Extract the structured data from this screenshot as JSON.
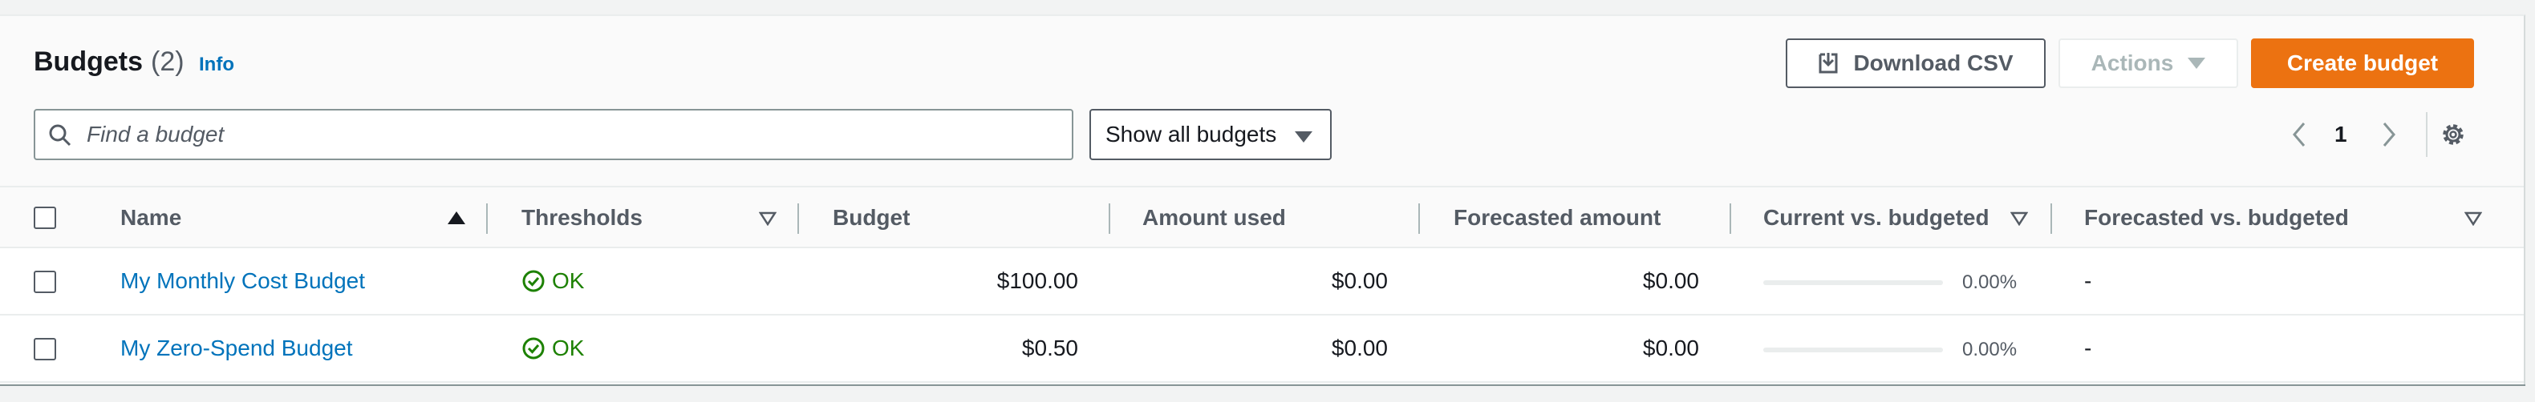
{
  "header": {
    "title": "Budgets",
    "count": "(2)",
    "info_label": "Info"
  },
  "toolbar": {
    "download_label": "Download CSV",
    "actions_label": "Actions",
    "create_label": "Create budget"
  },
  "search": {
    "placeholder": "Find a budget",
    "value": ""
  },
  "filter": {
    "selected": "Show all budgets"
  },
  "pagination": {
    "current_page": "1"
  },
  "table": {
    "columns": [
      {
        "label": "Name",
        "sort": "ascending"
      },
      {
        "label": "Thresholds",
        "sort": "sortable"
      },
      {
        "label": "Budget",
        "sort": "none"
      },
      {
        "label": "Amount used",
        "sort": "none"
      },
      {
        "label": "Forecasted amount",
        "sort": "none"
      },
      {
        "label": "Current vs. budgeted",
        "sort": "sortable"
      },
      {
        "label": "Forecasted vs. budgeted",
        "sort": "sortable"
      }
    ],
    "rows": [
      {
        "name": "My Monthly Cost Budget",
        "threshold": "OK",
        "budget": "$100.00",
        "amount_used": "$0.00",
        "forecasted": "$0.00",
        "current_vs_budgeted_pct": "0.00%",
        "current_vs_budgeted_fraction": 0,
        "forecasted_vs_budgeted": "-"
      },
      {
        "name": "My Zero-Spend Budget",
        "threshold": "OK",
        "budget": "$0.50",
        "amount_used": "$0.00",
        "forecasted": "$0.00",
        "current_vs_budgeted_pct": "0.00%",
        "current_vs_budgeted_fraction": 0,
        "forecasted_vs_budgeted": "-"
      }
    ]
  },
  "icons": {
    "search": "search-icon",
    "download": "download-icon",
    "status_ok": "check-circle-icon",
    "settings": "gear-icon",
    "prev": "chevron-left-icon",
    "next": "chevron-right-icon"
  },
  "colors": {
    "primary": "#ec7211",
    "link": "#0073bb",
    "success": "#1d8102"
  }
}
